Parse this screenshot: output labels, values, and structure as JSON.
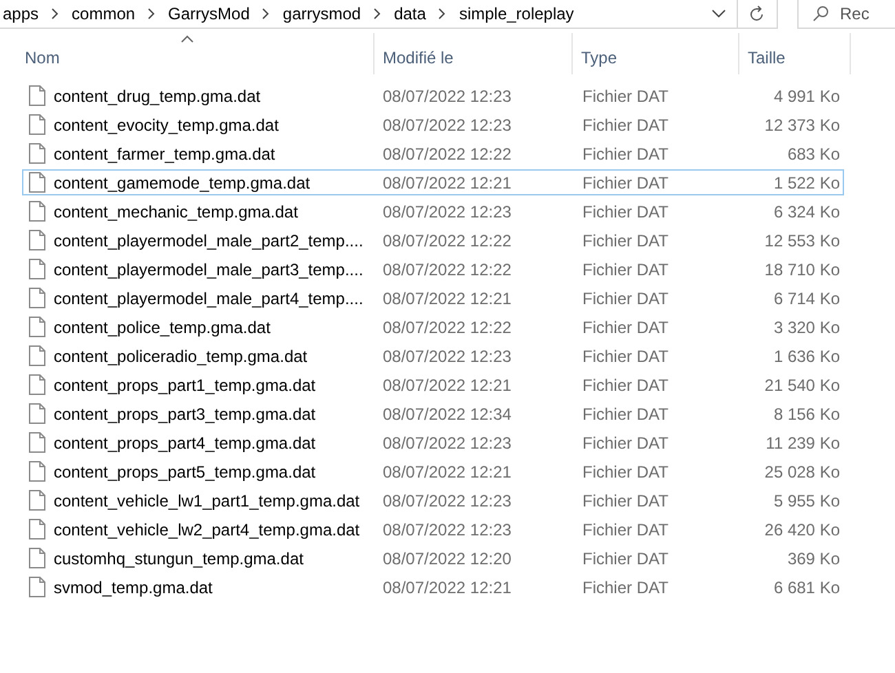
{
  "address_bar": {
    "breadcrumbs": [
      "apps",
      "common",
      "GarrysMod",
      "garrysmod",
      "data",
      "simple_roleplay"
    ]
  },
  "search": {
    "placeholder": "Rec"
  },
  "columns": [
    {
      "label": "Nom",
      "sorted": true
    },
    {
      "label": "Modifié le",
      "sorted": false
    },
    {
      "label": "Type",
      "sorted": false
    },
    {
      "label": "Taille",
      "sorted": false
    }
  ],
  "files": [
    {
      "name": "content_drug_temp.gma.dat",
      "modified": "08/07/2022 12:23",
      "type": "Fichier DAT",
      "size": "4 991 Ko",
      "focused": false
    },
    {
      "name": "content_evocity_temp.gma.dat",
      "modified": "08/07/2022 12:23",
      "type": "Fichier DAT",
      "size": "12 373 Ko",
      "focused": false
    },
    {
      "name": "content_farmer_temp.gma.dat",
      "modified": "08/07/2022 12:22",
      "type": "Fichier DAT",
      "size": "683 Ko",
      "focused": false
    },
    {
      "name": "content_gamemode_temp.gma.dat",
      "modified": "08/07/2022 12:21",
      "type": "Fichier DAT",
      "size": "1 522 Ko",
      "focused": true
    },
    {
      "name": "content_mechanic_temp.gma.dat",
      "modified": "08/07/2022 12:23",
      "type": "Fichier DAT",
      "size": "6 324 Ko",
      "focused": false
    },
    {
      "name": "content_playermodel_male_part2_temp....",
      "modified": "08/07/2022 12:22",
      "type": "Fichier DAT",
      "size": "12 553 Ko",
      "focused": false
    },
    {
      "name": "content_playermodel_male_part3_temp....",
      "modified": "08/07/2022 12:22",
      "type": "Fichier DAT",
      "size": "18 710 Ko",
      "focused": false
    },
    {
      "name": "content_playermodel_male_part4_temp....",
      "modified": "08/07/2022 12:21",
      "type": "Fichier DAT",
      "size": "6 714 Ko",
      "focused": false
    },
    {
      "name": "content_police_temp.gma.dat",
      "modified": "08/07/2022 12:22",
      "type": "Fichier DAT",
      "size": "3 320 Ko",
      "focused": false
    },
    {
      "name": "content_policeradio_temp.gma.dat",
      "modified": "08/07/2022 12:23",
      "type": "Fichier DAT",
      "size": "1 636 Ko",
      "focused": false
    },
    {
      "name": "content_props_part1_temp.gma.dat",
      "modified": "08/07/2022 12:21",
      "type": "Fichier DAT",
      "size": "21 540 Ko",
      "focused": false
    },
    {
      "name": "content_props_part3_temp.gma.dat",
      "modified": "08/07/2022 12:34",
      "type": "Fichier DAT",
      "size": "8 156 Ko",
      "focused": false
    },
    {
      "name": "content_props_part4_temp.gma.dat",
      "modified": "08/07/2022 12:23",
      "type": "Fichier DAT",
      "size": "11 239 Ko",
      "focused": false
    },
    {
      "name": "content_props_part5_temp.gma.dat",
      "modified": "08/07/2022 12:21",
      "type": "Fichier DAT",
      "size": "25 028 Ko",
      "focused": false
    },
    {
      "name": "content_vehicle_lw1_part1_temp.gma.dat",
      "modified": "08/07/2022 12:23",
      "type": "Fichier DAT",
      "size": "5 955 Ko",
      "focused": false
    },
    {
      "name": "content_vehicle_lw2_part4_temp.gma.dat",
      "modified": "08/07/2022 12:23",
      "type": "Fichier DAT",
      "size": "26 420 Ko",
      "focused": false
    },
    {
      "name": "customhq_stungun_temp.gma.dat",
      "modified": "08/07/2022 12:20",
      "type": "Fichier DAT",
      "size": "369 Ko",
      "focused": false
    },
    {
      "name": "svmod_temp.gma.dat",
      "modified": "08/07/2022 12:21",
      "type": "Fichier DAT",
      "size": "6 681 Ko",
      "focused": false
    }
  ]
}
